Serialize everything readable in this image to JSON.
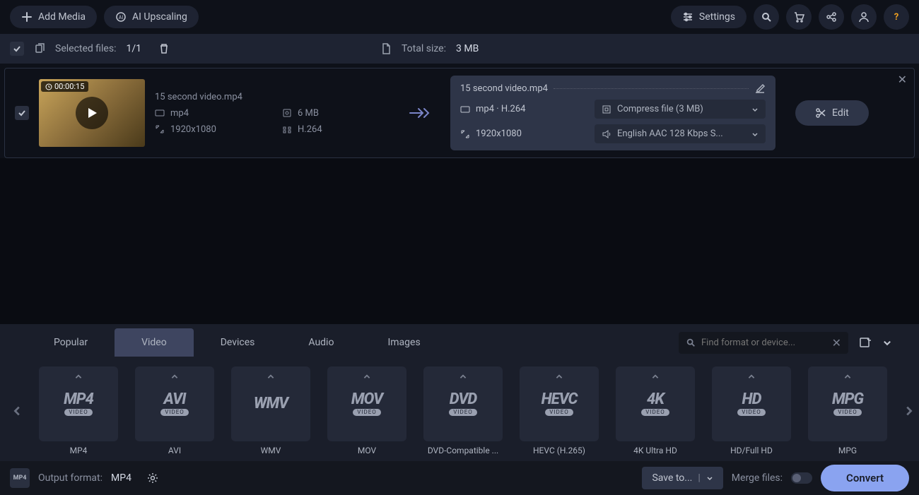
{
  "topbar": {
    "add_media": "Add Media",
    "ai_upscaling": "AI Upscaling",
    "settings": "Settings"
  },
  "selected_bar": {
    "label": "Selected files:",
    "count": "1/1",
    "total_size_label": "Total size:",
    "total_size": "3 MB"
  },
  "file": {
    "name": "15 second video.mp4",
    "duration": "00:00:15",
    "src": {
      "format": "mp4",
      "size": "6 MB",
      "resolution": "1920x1080",
      "codec": "H.264"
    },
    "out": {
      "title": "15 second video.mp4",
      "format": "mp4 · H.264",
      "resolution": "1920x1080",
      "compress": "Compress file (3 MB)",
      "audio": "English AAC 128 Kbps S..."
    },
    "edit": "Edit"
  },
  "tabs": [
    "Popular",
    "Video",
    "Devices",
    "Audio",
    "Images"
  ],
  "active_tab": "Video",
  "search_placeholder": "Find format or device...",
  "formats": [
    {
      "main": "MP4",
      "sub": "VIDEO",
      "label": "MP4"
    },
    {
      "main": "AVI",
      "sub": "VIDEO",
      "label": "AVI"
    },
    {
      "main": "WMV",
      "sub": "",
      "label": "WMV"
    },
    {
      "main": "MOV",
      "sub": "VIDEO",
      "label": "MOV"
    },
    {
      "main": "DVD",
      "sub": "VIDEO",
      "label": "DVD-Compatible ..."
    },
    {
      "main": "HEVC",
      "sub": "VIDEO",
      "label": "HEVC (H.265)"
    },
    {
      "main": "4K",
      "sub": "VIDEO",
      "label": "4K Ultra HD"
    },
    {
      "main": "HD",
      "sub": "VIDEO",
      "label": "HD/Full HD"
    },
    {
      "main": "MPG",
      "sub": "VIDEO",
      "label": "MPG"
    }
  ],
  "bottom": {
    "output_label": "Output format:",
    "output_value": "MP4",
    "save_to": "Save to...",
    "merge": "Merge files:",
    "convert": "Convert"
  }
}
